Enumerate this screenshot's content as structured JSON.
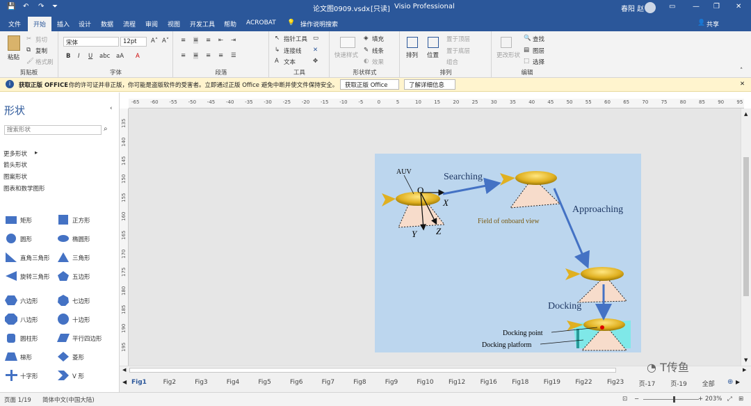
{
  "titlebar": {
    "document": "论文图0909.vsdx",
    "readonly": "[只读]",
    "app": "Visio Professional",
    "user": "春阳 赵"
  },
  "menu": {
    "items": [
      "文件",
      "开始",
      "插入",
      "设计",
      "数据",
      "流程",
      "审阅",
      "视图",
      "开发工具",
      "帮助",
      "ACROBAT"
    ],
    "active": "开始",
    "tellme": "操作说明搜索",
    "share": "共享"
  },
  "ribbon": {
    "clipboard": {
      "label": "剪贴板",
      "paste": "粘贴",
      "cut": "剪切",
      "copy": "复制",
      "format_painter": "格式刷"
    },
    "font": {
      "label": "字体",
      "family": "宋体",
      "size": "12pt"
    },
    "paragraph": {
      "label": "段落"
    },
    "tools": {
      "label": "工具",
      "pointer": "指针工具",
      "connector": "连接线",
      "text": "文本"
    },
    "shape_styles": {
      "label": "形状样式",
      "quick_styles": "快速样式",
      "fill": "填充",
      "line": "线条",
      "effects": "效果"
    },
    "arrange": {
      "label": "排列",
      "arrange": "排列",
      "position": "位置",
      "bring_front": "置于顶层",
      "send_back": "置于底层",
      "group": "组合"
    },
    "edit": {
      "label": "编辑",
      "change_shape": "更改形状",
      "find": "查找",
      "layers": "图层",
      "select": "选择"
    }
  },
  "infobar": {
    "title": "获取正版 OFFICE",
    "message": "你的许可证并非正版，你可能是盗版软件的受害者。立即通过正版 Office 避免中断并使文件保持安全。",
    "btn_get": "获取正版 Office",
    "btn_learn": "了解详细信息"
  },
  "shapes_panel": {
    "title": "形状",
    "search_placeholder": "搜索形状",
    "categories": [
      "更多形状",
      "箭头形状",
      "图案形状",
      "图表和数学图形"
    ],
    "items": [
      {
        "label": "矩形",
        "icon": "rectangle-icon"
      },
      {
        "label": "正方形",
        "icon": "square-icon"
      },
      {
        "label": "圆形",
        "icon": "circle-icon"
      },
      {
        "label": "椭圆形",
        "icon": "ellipse-icon"
      },
      {
        "label": "直角三角形",
        "icon": "right-triangle-icon"
      },
      {
        "label": "三角形",
        "icon": "triangle-icon"
      },
      {
        "label": "旋转三角形",
        "icon": "rotated-triangle-icon"
      },
      {
        "label": "五边形",
        "icon": "pentagon-icon"
      },
      {
        "label": "六边形",
        "icon": "hexagon-icon"
      },
      {
        "label": "七边形",
        "icon": "heptagon-icon"
      },
      {
        "label": "八边形",
        "icon": "octagon-icon"
      },
      {
        "label": "十边形",
        "icon": "decagon-icon"
      },
      {
        "label": "圆柱形",
        "icon": "cylinder-icon"
      },
      {
        "label": "平行四边形",
        "icon": "parallelogram-icon"
      },
      {
        "label": "梯形",
        "icon": "trapezoid-icon"
      },
      {
        "label": "菱形",
        "icon": "diamond-icon"
      },
      {
        "label": "十字形",
        "icon": "cross-icon"
      },
      {
        "label": "V 形",
        "icon": "chevron-icon"
      }
    ]
  },
  "ruler_top": [
    "-65",
    "-60",
    "-55",
    "-50",
    "-45",
    "-40",
    "-35",
    "-30",
    "-25",
    "-20",
    "-15",
    "-10",
    "-5",
    "0",
    "5",
    "10",
    "15",
    "20",
    "25",
    "30",
    "35",
    "40",
    "45",
    "50",
    "55",
    "60",
    "65",
    "70",
    "75",
    "80",
    "85",
    "90",
    "95"
  ],
  "ruler_left": [
    "135",
    "140",
    "145",
    "150",
    "155",
    "160",
    "165",
    "170",
    "175",
    "180",
    "185",
    "190",
    "195"
  ],
  "diagram": {
    "auv": "AUV",
    "origin": "O",
    "x": "X",
    "y": "Y",
    "z": "Z",
    "searching": "Searching",
    "approaching": "Approaching",
    "field": "Field of onboard view",
    "docking": "Docking",
    "docking_point": "Docking point",
    "docking_platform": "Docking platform"
  },
  "page_tabs": [
    "Fig1",
    "Fig2",
    "Fig3",
    "Fig4",
    "Fig5",
    "Fig6",
    "Fig7",
    "Fig8",
    "Fig9",
    "Fig10",
    "Fig12",
    "Fig16",
    "Fig18",
    "Fig19",
    "Fig22",
    "Fig23",
    "页-17",
    "页-19",
    "全部"
  ],
  "active_tab": "Fig1",
  "status": {
    "page": "页面 1/19",
    "language": "简体中文(中国大陆)",
    "zoom": "203%"
  },
  "watermark": "T传鱼",
  "colors": {
    "accent": "#2b579a",
    "drawing_bg": "#bcd6ee",
    "arrow": "#4472c4",
    "shape": "#4472c4"
  }
}
